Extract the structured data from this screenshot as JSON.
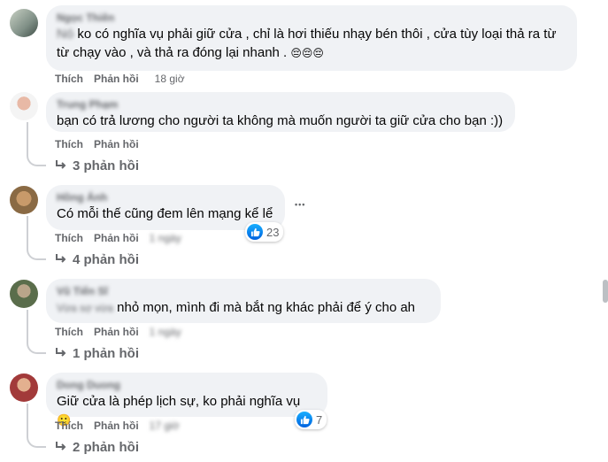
{
  "comments": [
    {
      "author": "Ngọc Thiên",
      "prefix": "Nó",
      "text": "ko có nghĩa vụ phải giữ cửa , chỉ là hơi thiếu nhạy bén thôi , cửa tùy loại thả ra từ từ chạy vào , và thả ra đóng lại nhanh .",
      "emoji": "😔😔😔",
      "like": "Thích",
      "reply": "Phản hồi",
      "time": "18 giờ"
    },
    {
      "author": "Trung Phạm",
      "text": "bạn có trả lương cho người ta không mà muốn người ta giữ cửa cho bạn :))",
      "like": "Thích",
      "reply": "Phản hồi",
      "replies": "3 phản hồi"
    },
    {
      "author": "Hồng Ánh",
      "text": "Có mỗi thế cũng đem lên mạng kể lể",
      "more": "•••",
      "reaction_count": "23",
      "like": "Thích",
      "reply": "Phản hồi",
      "time": "1 ngày",
      "replies": "4 phản hồi"
    },
    {
      "author": "Vũ Tiến Sĩ",
      "prefix": "Vừa sợ vừa",
      "text": "nhỏ mọn, mình đi mà bắt ng khác phải để ý cho ah",
      "like": "Thích",
      "reply": "Phản hồi",
      "time": "1 ngày",
      "replies": "1 phản hồi"
    },
    {
      "author": "Dong Duong",
      "text": "Giữ cửa là phép lịch sự, ko phải nghĩa vụ",
      "emoji": "🙂",
      "reaction_count": "7",
      "like": "Thích",
      "reply": "Phản hồi",
      "time": "17 giờ",
      "replies": "2 phản hồi"
    }
  ],
  "colors": {
    "bubble": "#f0f2f5",
    "secondary_text": "#65676b",
    "like_blue": "#0866ff"
  },
  "icons": {
    "reply_arrow": "reply-arrow-icon",
    "like": "like-icon",
    "more": "more-icon"
  }
}
